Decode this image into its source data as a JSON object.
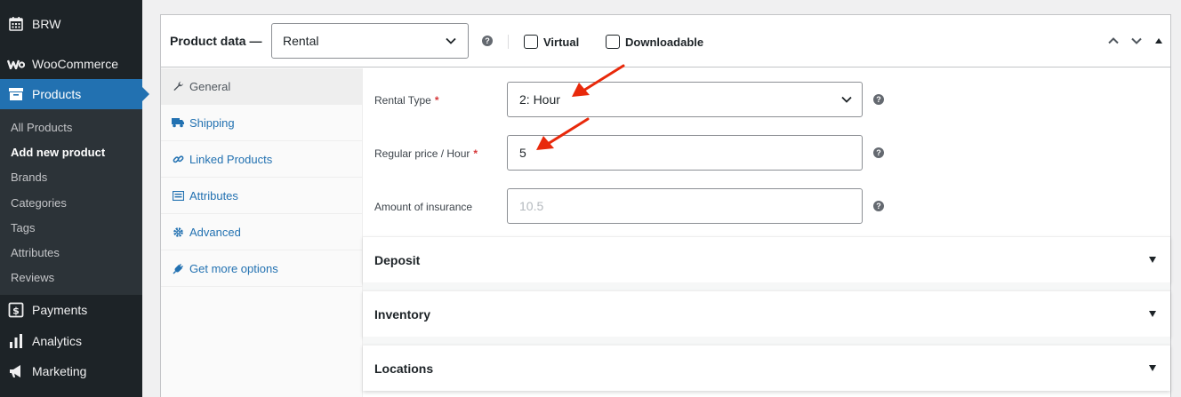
{
  "sidebar": {
    "brw": "BRW",
    "woocommerce": "WooCommerce",
    "products": "Products",
    "submenu": [
      "All Products",
      "Add new product",
      "Brands",
      "Categories",
      "Tags",
      "Attributes",
      "Reviews"
    ],
    "payments": "Payments",
    "analytics": "Analytics",
    "marketing": "Marketing"
  },
  "product_data": {
    "title": "Product data —",
    "type_selected": "Rental",
    "virtual_label": "Virtual",
    "downloadable_label": "Downloadable",
    "help_glyph": "?"
  },
  "tabs": [
    "General",
    "Shipping",
    "Linked Products",
    "Attributes",
    "Advanced",
    "Get more options"
  ],
  "fields": {
    "rental_type_label": "Rental Type",
    "rental_type_value": "2: Hour",
    "regular_price_label": "Regular price / Hour",
    "regular_price_value": "5",
    "insurance_label": "Amount of insurance",
    "insurance_placeholder": "10.5",
    "required_mark": "*"
  },
  "sections": [
    "Deposit",
    "Inventory",
    "Locations"
  ],
  "colors": {
    "accent": "#2271b1",
    "sidebar": "#1d2327",
    "required": "#d63638",
    "annotation_arrow": "#e8290b"
  }
}
